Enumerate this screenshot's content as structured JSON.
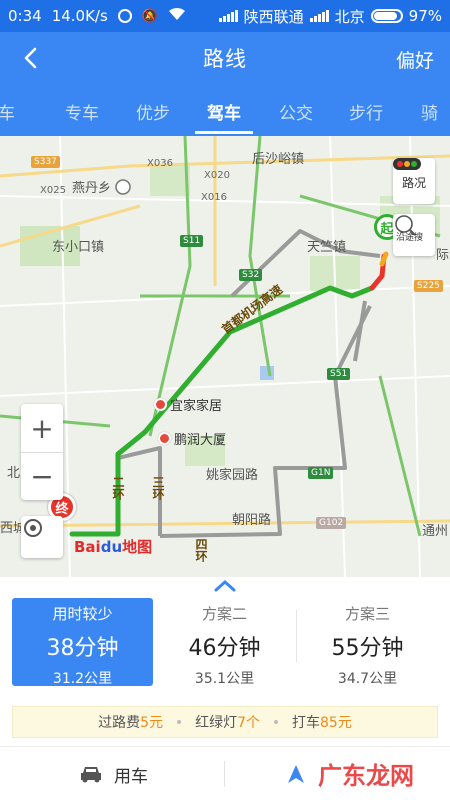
{
  "status_bar": {
    "time": "0:34",
    "speed": "14.0K/s",
    "carrier1": "陕西联通",
    "carrier2": "北京",
    "battery": "97%"
  },
  "header": {
    "title": "路线",
    "pref_label": "偏好"
  },
  "tabs": [
    {
      "label": "车",
      "active": false
    },
    {
      "label": "专车",
      "active": false
    },
    {
      "label": "优步",
      "active": false
    },
    {
      "label": "驾车",
      "active": true
    },
    {
      "label": "公交",
      "active": false
    },
    {
      "label": "步行",
      "active": false
    },
    {
      "label": "骑",
      "active": false
    }
  ],
  "map": {
    "traffic_label": "路况",
    "search_along_label": "沿途搜",
    "start_label": "起",
    "end_label": "终",
    "zoom_in": "+",
    "zoom_out": "−",
    "logo_bai": "Bai",
    "logo_du": "du",
    "logo_map": "地图",
    "places": {
      "yandanshan": "燕丹乡",
      "houshayu": "后沙峪镇",
      "dongxiaokou": "东小口镇",
      "tianzhu": "天竺镇",
      "ji": "际",
      "yijiajiaju": "宜家家居",
      "pengrun": "鹏润大厦",
      "yaojiayuan": "姚家园路",
      "chaoyang": "朝阳路",
      "tongzhou": "通州",
      "bei": "北",
      "xicheng": "西城",
      "airport_expwy": "首都机场高速",
      "ring2": "二环",
      "ring3": "三环",
      "ring4": "四环"
    },
    "shields": {
      "s337": "S337",
      "x036": "X036",
      "x025": "X025",
      "x020": "X020",
      "x016": "X016",
      "s11": "S11",
      "s32": "S32",
      "s51": "S51",
      "s225": "S225",
      "g1n": "G1N",
      "g102": "G102"
    },
    "colors": {
      "route": "#2fae2f",
      "alt_route": "#9a9a9a",
      "congestion": "#e8352b"
    }
  },
  "plans": [
    {
      "title": "用时较少",
      "time": "38分钟",
      "distance": "31.2公里",
      "selected": true
    },
    {
      "title": "方案二",
      "time": "46分钟",
      "distance": "35.1公里",
      "selected": false
    },
    {
      "title": "方案三",
      "time": "55分钟",
      "distance": "34.7公里",
      "selected": false
    }
  ],
  "fees": {
    "toll_label": "过路费",
    "toll_value": "5元",
    "lights_label": "红绿灯",
    "lights_value": "7个",
    "taxi_label": "打车",
    "taxi_value": "85元"
  },
  "bottom": {
    "car_label": "用车",
    "watermark": "广东龙网"
  }
}
